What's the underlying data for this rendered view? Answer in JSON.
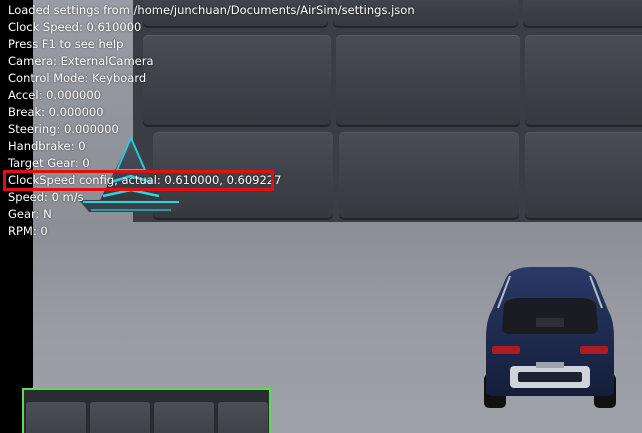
{
  "hud": {
    "lines": [
      "Loaded settings from /home/junchuan/Documents/AirSim/settings.json",
      "Clock Speed: 0.610000",
      "Press F1 to see help",
      "Camera: ExternalCamera",
      "Control Mode: Keyboard",
      "Accel: 0.000000",
      "Break: 0.000000",
      "Steering: 0.000000",
      "Handbrake: 0",
      "Target Gear: 0",
      "ClockSpeed config, actual: 0.610000, 0.609227",
      "Speed: 0 m/s",
      "Gear: N",
      "RPM: 0"
    ],
    "highlighted_line_index": 10
  },
  "scene": {
    "objects": [
      "wall",
      "floor",
      "traffic-cone",
      "car"
    ],
    "colors": {
      "highlight_border": "#e01010",
      "subwindow_border": "#57e04c",
      "cone_glow": "#29d3e8",
      "car_body": "#1b2a52"
    }
  },
  "subwindow": {
    "label": ""
  }
}
